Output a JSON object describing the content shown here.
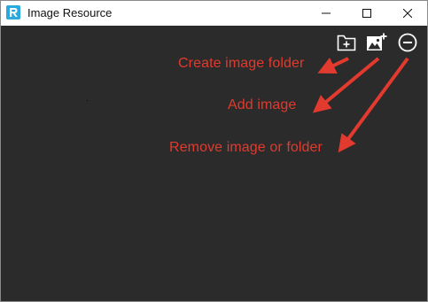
{
  "window": {
    "title": "Image Resource",
    "app_icon": "r-logo-icon",
    "controls": [
      "minimize-icon",
      "maximize-icon",
      "close-icon"
    ]
  },
  "toolbar": {
    "buttons": [
      {
        "name": "create-folder-button",
        "icon": "folder-plus-icon"
      },
      {
        "name": "add-image-button",
        "icon": "image-plus-icon"
      },
      {
        "name": "remove-button",
        "icon": "minus-circle-icon"
      }
    ]
  },
  "annotations": {
    "create_folder": "Create image folder",
    "add_image": "Add image",
    "remove": "Remove image or folder"
  },
  "colors": {
    "content_bg": "#2b2b2b",
    "annotation": "#e23a2e",
    "icon": "#ffffff",
    "app_icon": "#29a9e0"
  }
}
